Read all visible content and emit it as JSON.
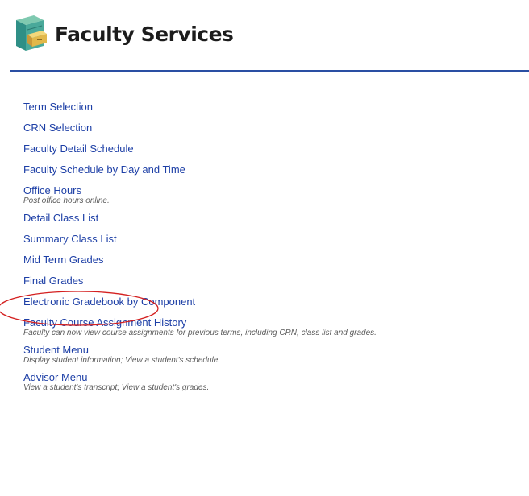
{
  "header": {
    "title": "Faculty Services",
    "icon": "file-cabinet-icon"
  },
  "menu": {
    "items": [
      {
        "label": "Term Selection",
        "description": ""
      },
      {
        "label": "CRN Selection",
        "description": ""
      },
      {
        "label": "Faculty Detail Schedule",
        "description": ""
      },
      {
        "label": "Faculty Schedule by Day and Time",
        "description": ""
      },
      {
        "label": "Office Hours",
        "description": "Post office hours online."
      },
      {
        "label": "Detail Class List",
        "description": ""
      },
      {
        "label": "Summary Class List",
        "description": ""
      },
      {
        "label": "Mid Term Grades",
        "description": ""
      },
      {
        "label": "Final Grades",
        "description": ""
      },
      {
        "label": "Electronic Gradebook by Component",
        "description": ""
      },
      {
        "label": "Faculty Course Assignment History",
        "description": "Faculty can now view course assignments for previous terms, including CRN, class list and grades."
      },
      {
        "label": "Student Menu",
        "description": "Display student information; View a student's schedule."
      },
      {
        "label": "Advisor Menu",
        "description": "View a student's transcript; View a student's grades."
      }
    ]
  },
  "annotation": {
    "highlighted_item": "Mid Term Grades",
    "color": "#d42020"
  },
  "colors": {
    "link": "#1d3fa6",
    "rule": "#2a4fa3",
    "description": "#5c5c5c"
  }
}
